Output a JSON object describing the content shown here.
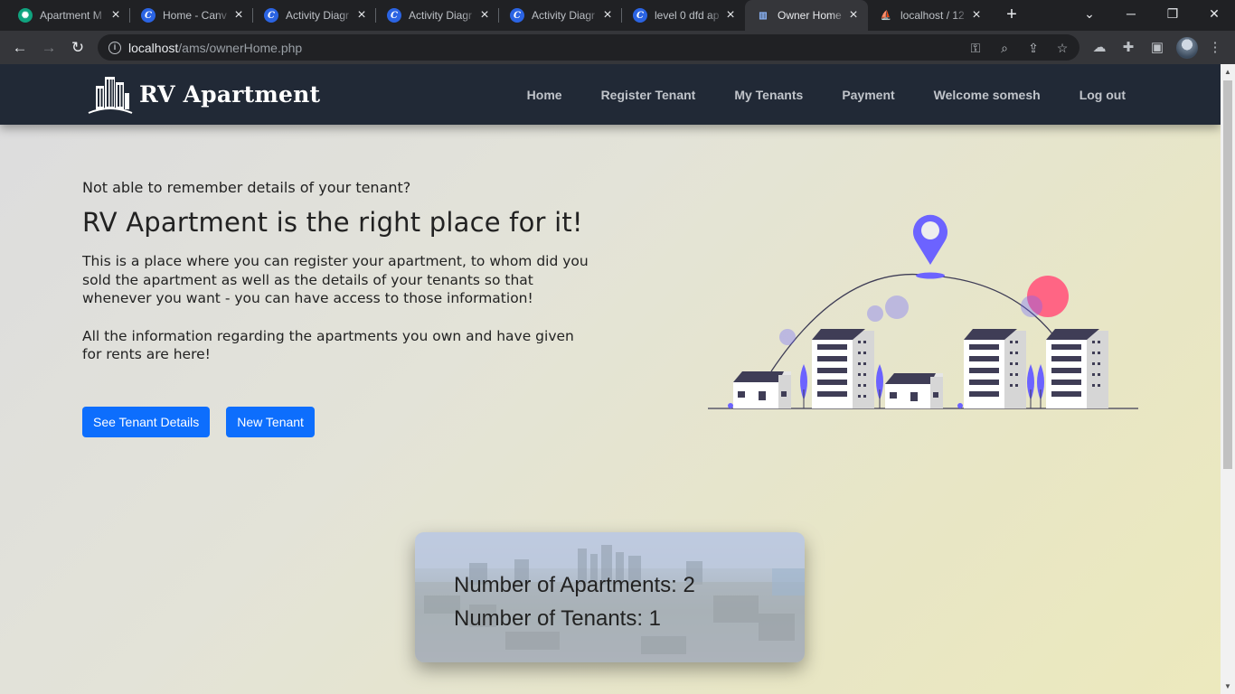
{
  "browser": {
    "tabs": [
      {
        "title": "Apartment M",
        "favicon": "chatgpt-icon"
      },
      {
        "title": "Home - Canv",
        "favicon": "canva-icon"
      },
      {
        "title": "Activity Diagr",
        "favicon": "canva-icon"
      },
      {
        "title": "Activity Diagr",
        "favicon": "canva-icon"
      },
      {
        "title": "Activity Diagr",
        "favicon": "canva-icon"
      },
      {
        "title": "level 0 dfd ap",
        "favicon": "canva-icon"
      },
      {
        "title": "Owner Home",
        "favicon": "building-icon",
        "active": true
      },
      {
        "title": "localhost / 12",
        "favicon": "phpmyadmin-icon"
      }
    ],
    "url_host": "localhost",
    "url_path": "/ams/ownerHome.php"
  },
  "navbar": {
    "brand": "RV Apartment",
    "links": [
      "Home",
      "Register Tenant",
      "My Tenants",
      "Payment",
      "Welcome somesh",
      "Log out"
    ]
  },
  "hero": {
    "question": "Not able to remember details of your tenant?",
    "heading": "RV Apartment is the right place for it!",
    "paragraph1": "This is a place where you can register your apartment, to whom did you sold the apartment as well as the details of your tenants so that whenever you want - you can have access to those information!",
    "paragraph2": "All the information regarding the apartments you own and have given for rents are here!",
    "button_details": "See Tenant Details",
    "button_new": "New Tenant"
  },
  "stats": {
    "apartments": "Number of Apartments: 2",
    "tenants": "Number of Tenants: 1"
  },
  "colors": {
    "navbar": "#212936",
    "primary": "#0d6efd",
    "accent_purple": "#6c63ff",
    "accent_pink": "#ff6584"
  }
}
